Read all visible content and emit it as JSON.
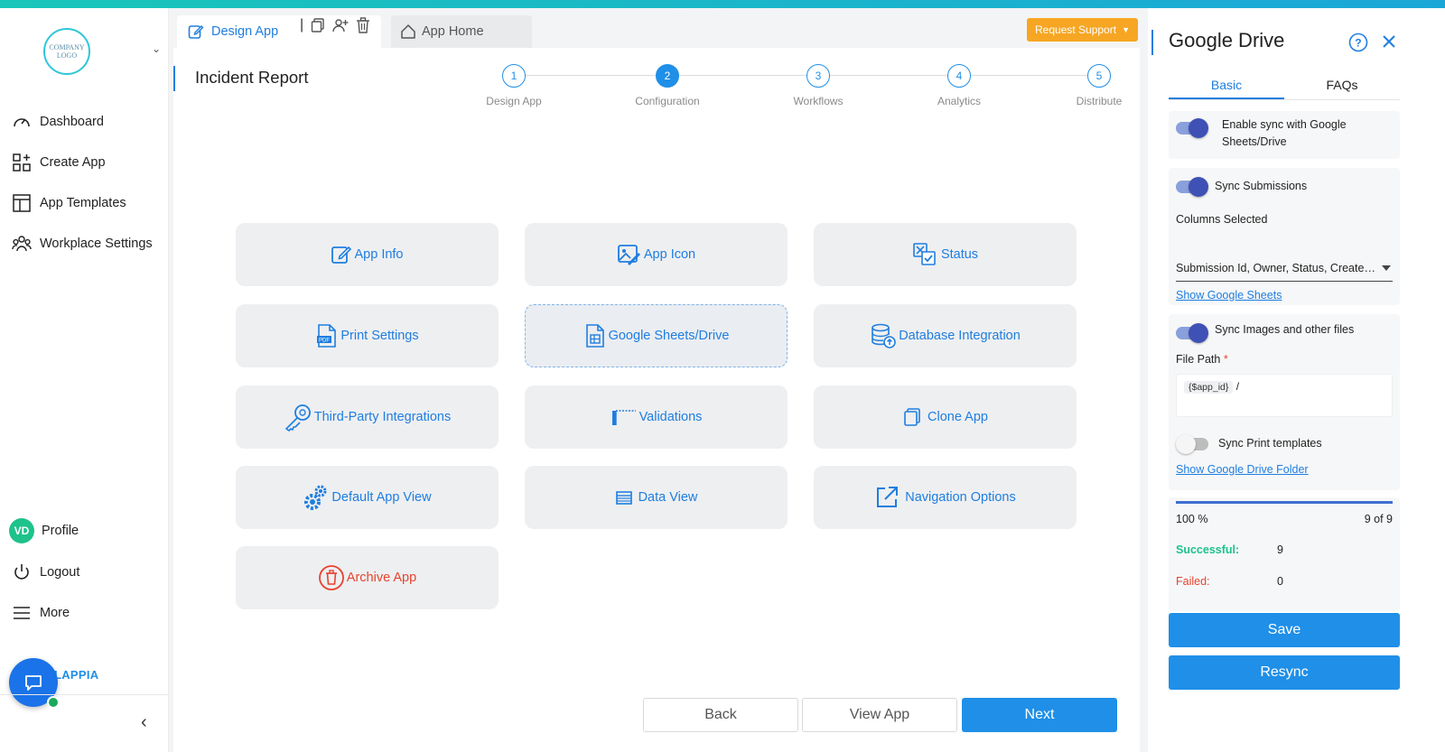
{
  "sidebar": {
    "logo_text_1": "COMPANY",
    "logo_text_2": "LOGO",
    "nav": [
      {
        "label": "Dashboard",
        "icon": "gauge-icon"
      },
      {
        "label": "Create App",
        "icon": "grid-plus-icon"
      },
      {
        "label": "App Templates",
        "icon": "template-icon"
      },
      {
        "label": "Workplace Settings",
        "icon": "team-icon"
      }
    ],
    "profile_initials": "VD",
    "profile_label": "Profile",
    "logout_label": "Logout",
    "more_label": "More",
    "brand": "LAPPIA"
  },
  "tabs": {
    "design_app": "Design App",
    "app_home": "App Home",
    "request_support": "Request Support"
  },
  "page": {
    "title": "Incident Report"
  },
  "stepper": [
    {
      "num": "1",
      "label": "Design App"
    },
    {
      "num": "2",
      "label": "Configuration",
      "active": true
    },
    {
      "num": "3",
      "label": "Workflows"
    },
    {
      "num": "4",
      "label": "Analytics"
    },
    {
      "num": "5",
      "label": "Distribute"
    }
  ],
  "cards": [
    {
      "label": "App Info",
      "icon": "edit-icon"
    },
    {
      "label": "App Icon",
      "icon": "image-edit-icon"
    },
    {
      "label": "Status",
      "icon": "status-icon"
    },
    {
      "label": "Print Settings",
      "icon": "pdf-icon"
    },
    {
      "label": "Google Sheets/Drive",
      "icon": "sheet-icon"
    },
    {
      "label": "Database Integration",
      "icon": "database-icon"
    },
    {
      "label": "Third-Party Integrations",
      "icon": "key-icon"
    },
    {
      "label": "Validations",
      "icon": "ruler-icon"
    },
    {
      "label": "Clone App",
      "icon": "copy-icon"
    },
    {
      "label": "Default App View",
      "icon": "gears-icon"
    },
    {
      "label": "Data View",
      "icon": "table-icon"
    },
    {
      "label": "Navigation Options",
      "icon": "external-link-icon"
    },
    {
      "label": "Archive App",
      "icon": "trash-circle-icon"
    }
  ],
  "footer": {
    "back": "Back",
    "view_app": "View App",
    "next": "Next"
  },
  "panel": {
    "title": "Google Drive",
    "tab_basic": "Basic",
    "tab_faqs": "FAQs",
    "enable_sync": "Enable sync with Google Sheets/Drive",
    "sync_submissions": "Sync Submissions",
    "columns_selected_label": "Columns Selected",
    "columns_selected_value": "Submission Id, Owner, Status, Created...",
    "show_google_sheets": "Show Google Sheets",
    "sync_images": "Sync Images and other files",
    "file_path_label": "File Path",
    "required_mark": "*",
    "file_path_tag": "{$app_id}",
    "file_path_suffix": "/",
    "sync_print": "Sync Print templates",
    "show_drive_folder": "Show Google Drive Folder",
    "progress_percent": "100 %",
    "progress_count": "9 of 9",
    "successful_label": "Successful:",
    "successful_value": "9",
    "failed_label": "Failed:",
    "failed_value": "0",
    "save": "Save",
    "resync": "Resync"
  },
  "colors": {
    "accent": "#1f8fe8",
    "warning": "#f6a623",
    "success": "#1ec28b",
    "danger": "#e8432f",
    "toggle": "#3f51b5"
  }
}
